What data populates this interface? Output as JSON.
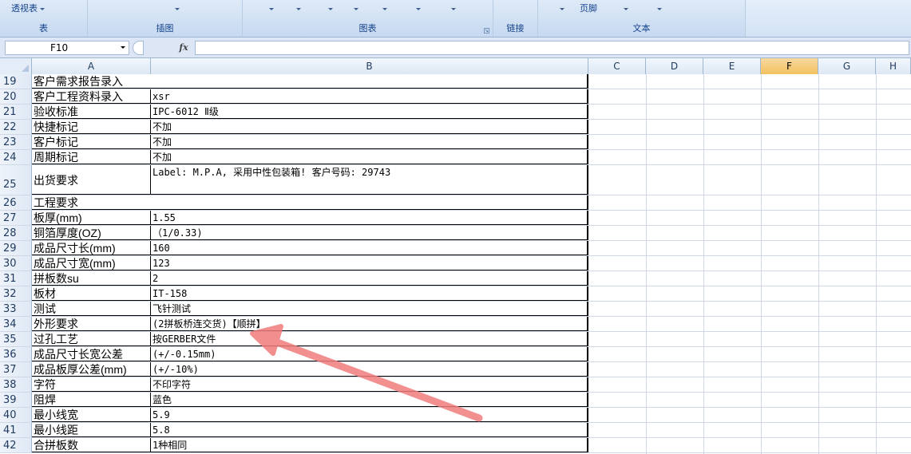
{
  "ribbon": {
    "pivot_label": "透视表",
    "footer_label": "页脚",
    "groups": {
      "table": "表",
      "illustrations": "插图",
      "charts": "图表",
      "links": "链接",
      "text": "文本"
    }
  },
  "formula_bar": {
    "name_box": "F10",
    "fx_label": "fx",
    "formula": ""
  },
  "columns": [
    "A",
    "B",
    "C",
    "D",
    "E",
    "F",
    "G",
    "H"
  ],
  "selected_column": "F",
  "rows": [
    {
      "num": "19",
      "a": "客户需求报告录入",
      "b": "",
      "span": true
    },
    {
      "num": "20",
      "a": "客户工程资料录入",
      "b": "xsr"
    },
    {
      "num": "21",
      "a": "验收标准",
      "b": "IPC-6012 Ⅱ级"
    },
    {
      "num": "22",
      "a": "快捷标记",
      "b": "不加"
    },
    {
      "num": "23",
      "a": "客户标记",
      "b": "不加"
    },
    {
      "num": "24",
      "a": "周期标记",
      "b": "不加"
    },
    {
      "num": "25",
      "a": "出货要求",
      "b": "Label: M.P.A, 采用中性包装箱! 客户号码: 29743",
      "tall": true
    },
    {
      "num": "26",
      "a": "工程要求",
      "b": "",
      "span": true
    },
    {
      "num": "27",
      "a": "板厚(mm)",
      "b": "1.55"
    },
    {
      "num": "28",
      "a": "铜箔厚度(OZ)",
      "b": "（1/0.33)"
    },
    {
      "num": "29",
      "a": "成品尺寸长(mm)",
      "b": "160"
    },
    {
      "num": "30",
      "a": "成品尺寸宽(mm)",
      "b": "123"
    },
    {
      "num": "31",
      "a": "拼板数su",
      "b": "2"
    },
    {
      "num": "32",
      "a": "板材",
      "b": "IT-158"
    },
    {
      "num": "33",
      "a": "测试",
      "b": "飞针测试"
    },
    {
      "num": "34",
      "a": "外形要求",
      "b": "(2拼板桥连交货)【顺拼】"
    },
    {
      "num": "35",
      "a": "过孔工艺",
      "b": "按GERBER文件"
    },
    {
      "num": "36",
      "a": "成品尺寸长宽公差",
      "b": "(+/-0.15mm)"
    },
    {
      "num": "37",
      "a": "成品板厚公差(mm)",
      "b": "(+/-10%)"
    },
    {
      "num": "38",
      "a": "字符",
      "b": "不印字符"
    },
    {
      "num": "39",
      "a": "阻焊",
      "b": "蓝色"
    },
    {
      "num": "40",
      "a": "最小线宽",
      "b": "5.9"
    },
    {
      "num": "41",
      "a": "最小线距",
      "b": "5.8"
    },
    {
      "num": "42",
      "a": "合拼板数",
      "b": "1种相同"
    }
  ],
  "annotation_color": "#f07b7b"
}
